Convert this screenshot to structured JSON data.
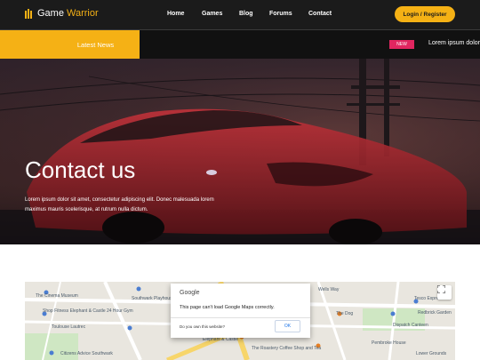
{
  "header": {
    "logo_main": "Game ",
    "logo_accent": "Warrior",
    "nav": [
      "Home",
      "Games",
      "Blog",
      "Forums",
      "Contact"
    ],
    "login_label": "Login / Register"
  },
  "news": {
    "latest_label": "Latest News",
    "badge": "NEW",
    "ticker": "Lorem ipsum dolor"
  },
  "hero": {
    "title": "Contact us",
    "text": "Lorem ipsum dolor sit amet, consectetur adipiscing elit. Donec malesuada lorem maximus mauris scelerisque, at rutrum nulla dictum."
  },
  "map": {
    "labels": {
      "cinema": "The Cinema Museum",
      "southwark": "Southwark Playhouse",
      "wells": "Wells Way",
      "elephant": "Shop Fitness Elephant & Castle 24 Hour Gym",
      "tesco": "Tesco Express",
      "dog": "The Dog",
      "redbrick": "Redbrick Garden",
      "dispatch": "Dispatch Canteen",
      "toulouse": "Toulouse Lautrec",
      "elephant_castle": "Elephant & Castle",
      "pembroke": "Pembroke House",
      "roastery": "The Roastery Coffee Shop and Tea",
      "citizens": "Citizens Advice Southwark",
      "lower": "Lower Grounds"
    },
    "dialog": {
      "brand": "Google",
      "message": "This page can't load Google Maps correctly.",
      "own_question": "Do you own this website?",
      "ok_label": "OK"
    }
  },
  "colors": {
    "accent": "#f5b115",
    "header_bg": "#1b1b1b",
    "news_bg": "#111111",
    "badge": "#e12660"
  }
}
